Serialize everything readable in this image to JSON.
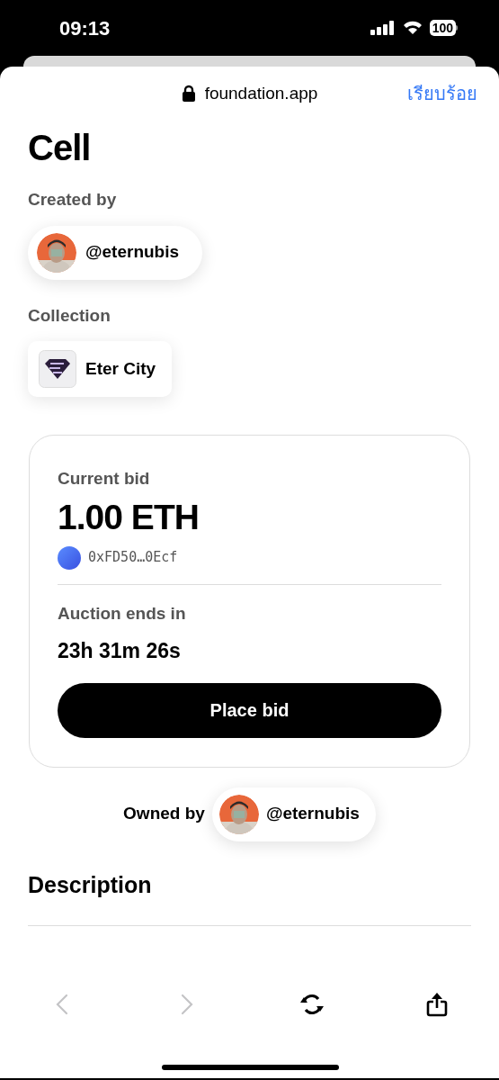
{
  "status_bar": {
    "time": "09:13",
    "battery": "100"
  },
  "browser": {
    "domain": "foundation.app",
    "done": "เรียบร้อย"
  },
  "artwork": {
    "title": "Cell"
  },
  "creator": {
    "label": "Created by",
    "handle": "@eternubis"
  },
  "collection": {
    "label": "Collection",
    "name": "Eter City"
  },
  "auction": {
    "bid_label": "Current bid",
    "bid": "1.00 ETH",
    "bidder": "0xFD50…0Ecf",
    "ends_label": "Auction ends in",
    "countdown": "23h 31m 26s",
    "button": "Place bid"
  },
  "owner": {
    "label": "Owned by",
    "handle": "@eternubis"
  },
  "description": {
    "heading": "Description"
  },
  "toolbar": [
    {
      "kind": "back",
      "disabled": true
    },
    {
      "kind": "forward",
      "disabled": true
    },
    {
      "kind": "reload",
      "disabled": false
    },
    {
      "kind": "share",
      "disabled": false
    }
  ]
}
